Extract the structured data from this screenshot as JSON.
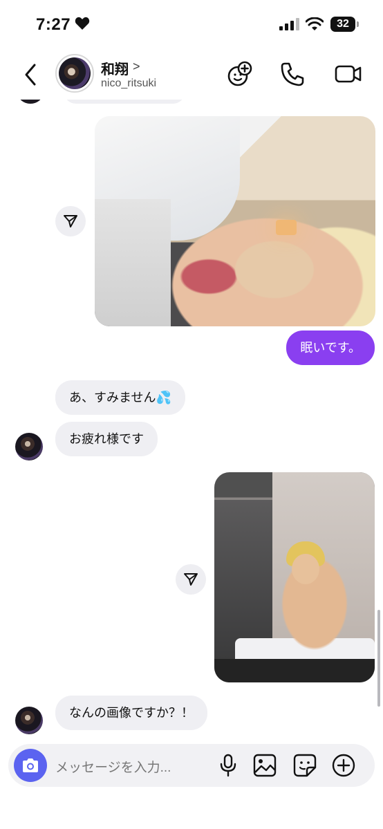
{
  "status_bar": {
    "time": "7:27",
    "battery": "32"
  },
  "header": {
    "name": "和翔",
    "name_chevron": ">",
    "username": "nico_ritsuki"
  },
  "messages": [
    {
      "type": "image",
      "side": "out"
    },
    {
      "type": "text",
      "side": "out",
      "text": "眠いです。"
    },
    {
      "type": "text",
      "side": "in",
      "text": "あ、すみません💦"
    },
    {
      "type": "text",
      "side": "in",
      "text": "お疲れ様です"
    },
    {
      "type": "image",
      "side": "out"
    },
    {
      "type": "text",
      "side": "in",
      "text": "なんの画像ですか？！"
    }
  ],
  "composer": {
    "placeholder": "メッセージを入力..."
  },
  "colors": {
    "accent": "#8a3ff0",
    "camera": "#5b63f0",
    "incoming_bubble": "#efeff3"
  },
  "icons": [
    "back-icon",
    "add-friend-icon",
    "phone-icon",
    "video-icon",
    "share-icon",
    "camera-icon",
    "mic-icon",
    "gallery-icon",
    "sticker-icon",
    "plus-icon"
  ]
}
